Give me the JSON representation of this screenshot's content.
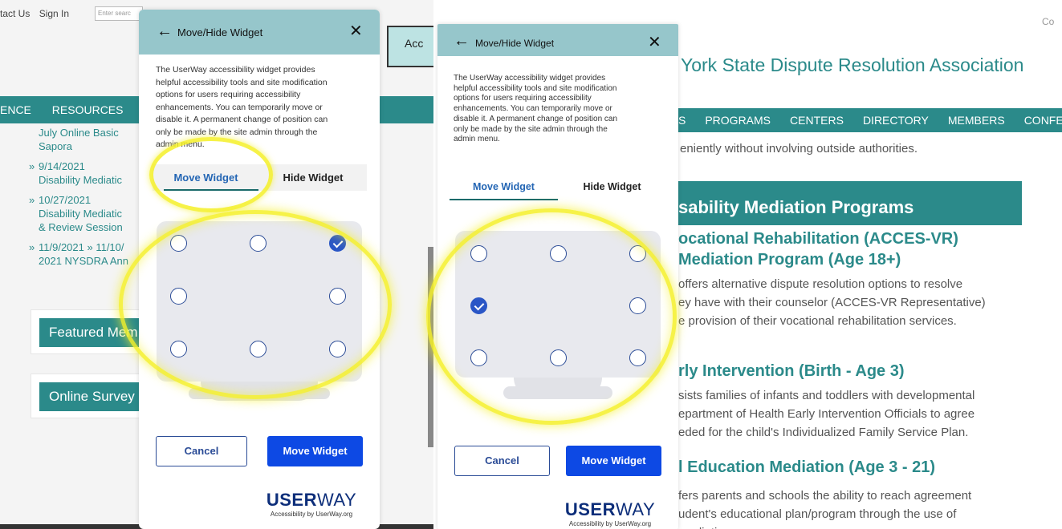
{
  "left_site": {
    "top_links": [
      "tact Us",
      "Sign In"
    ],
    "search_placeholder": "Enter searc",
    "nav": [
      "ENCE",
      "RESOURCES"
    ],
    "list": [
      {
        "lines": [
          "July Online Basic",
          "Sapora"
        ],
        "bullet": false
      },
      {
        "lines": [
          "9/14/2021",
          "Disability Mediatic"
        ],
        "bullet": true
      },
      {
        "lines": [
          "10/27/2021",
          "Disability Mediatic",
          "& Review Session"
        ],
        "bullet": true
      },
      {
        "lines": [
          "11/9/2021 » 11/10/",
          "2021 NYSDRA Ann"
        ],
        "bullet": true
      }
    ],
    "bullet_glyph": "»",
    "featured": "Featured Mem",
    "survey": "Online Survey",
    "acc_button": "Acc"
  },
  "dialog": {
    "back_icon": "←",
    "title": "Move/Hide Widget",
    "close_icon": "✕",
    "description_lines": [
      "The UserWay accessibility widget provides",
      "helpful accessibility tools and site modification",
      "options for users requiring accessibility",
      "enhancements. You can temporarily move or",
      "disable it. A permanent change of position can",
      "only be made by the site admin through the",
      "admin menu."
    ],
    "tab_move": "Move Widget",
    "tab_hide": "Hide Widget",
    "cancel": "Cancel",
    "move_button": "Move Widget",
    "logo_bold": "USER",
    "logo_light": "WAY",
    "logo_tagline": "Accessibility by UserWay.org"
  },
  "left_panel_selected": "top-right",
  "right_panel_selected": "middle-left",
  "right_site": {
    "corner": "Co",
    "org_name": "York State Dispute Resolution Association",
    "nav": [
      "S",
      "PROGRAMS",
      "CENTERS",
      "DIRECTORY",
      "MEMBERS",
      "CONFE"
    ],
    "intro": "eniently without involving outside authorities.",
    "band": "sability Mediation Programs",
    "sections": [
      {
        "heading_lines": [
          "ocational Rehabilitation (ACCES-VR)",
          "Mediation Program (Age 18+)"
        ],
        "text_lines": [
          "offers alternative dispute resolution options to resolve",
          "ey have with their counselor (ACCES-VR Representative)",
          "e provision of their vocational rehabilitation services."
        ]
      },
      {
        "heading_lines": [
          "rly Intervention (Birth - Age 3)"
        ],
        "text_lines": [
          "sists families of infants and toddlers with developmental",
          "epartment of Health Early Intervention Officials to agree",
          "eded for the child's Individualized Family Service Plan."
        ]
      },
      {
        "heading_lines": [
          "l Education Mediation (Age 3 - 21)"
        ],
        "text_lines": [
          "fers parents and schools the ability to reach agreement",
          "udent's educational plan/program through the use of",
          "mediation."
        ]
      }
    ]
  },
  "colors": {
    "teal": "#2b8a8a",
    "header": "#96c6cb",
    "primary_button": "#0d49e4",
    "highlight": "#f5f21a"
  }
}
